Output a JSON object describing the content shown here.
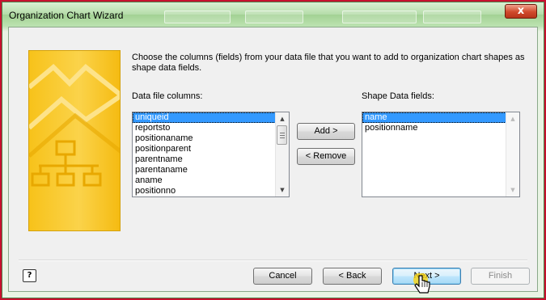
{
  "window": {
    "title": "Organization Chart Wizard",
    "close_glyph": "x"
  },
  "instructions": "Choose the columns (fields) from your data file that you want to add to organization chart shapes as shape data fields.",
  "data_columns": {
    "label": "Data file columns:",
    "items": [
      "uniqueid",
      "reportsto",
      "positionaname",
      "positionparent",
      "parentname",
      "parentaname",
      "aname",
      "positionno"
    ],
    "selected": "uniqueid"
  },
  "shape_fields": {
    "label": "Shape Data fields:",
    "items": [
      "name",
      "positionname"
    ],
    "selected": "name"
  },
  "buttons": {
    "add": "Add >",
    "remove": "< Remove",
    "cancel": "Cancel",
    "back": "< Back",
    "next": "Next >",
    "finish": "Finish",
    "help": "?"
  },
  "colors": {
    "banner": "#f7c21a",
    "highlight": "#3399ff",
    "frame_border": "#c8102e"
  }
}
